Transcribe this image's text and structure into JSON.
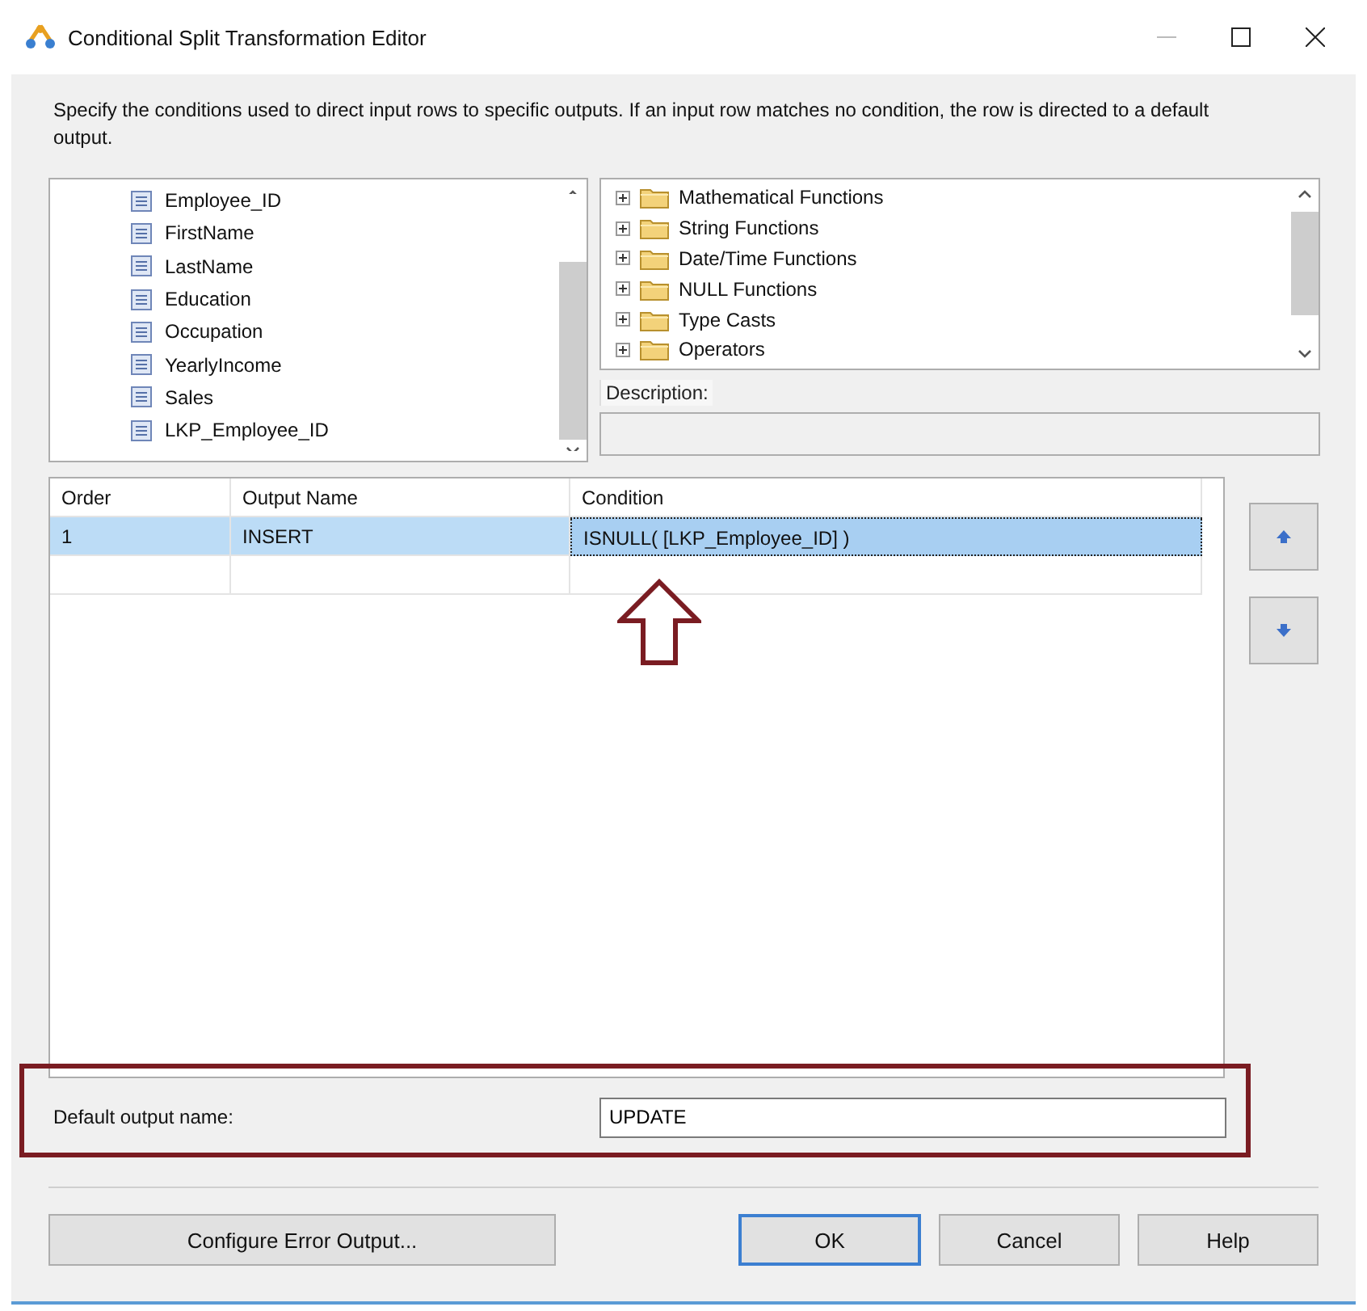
{
  "window": {
    "title": "Conditional Split Transformation Editor"
  },
  "intro": "Specify the conditions used to direct input rows to specific outputs. If an input row matches no condition, the row is directed to a default output.",
  "columns_list": {
    "items": [
      "Employee_ID",
      "FirstName",
      "LastName",
      "Education",
      "Occupation",
      "YearlyIncome",
      "Sales",
      "LKP_Employee_ID"
    ]
  },
  "functions_tree": {
    "items": [
      {
        "label": "Mathematical Functions",
        "expanded": false
      },
      {
        "label": "String Functions",
        "expanded": false
      },
      {
        "label": "Date/Time Functions",
        "expanded": false
      },
      {
        "label": "NULL Functions",
        "expanded": false
      },
      {
        "label": "Type Casts",
        "expanded": false
      },
      {
        "label": "Operators",
        "expanded": false
      }
    ]
  },
  "description": {
    "label": "Description:"
  },
  "table": {
    "columns": [
      "Order",
      "Output Name",
      "Condition"
    ],
    "rows": [
      {
        "cells": [
          "1",
          "INSERT",
          "ISNULL( [LKP_Employee_ID] )"
        ],
        "selected": true
      }
    ]
  },
  "default_output": {
    "label": "Default output name:",
    "value": "UPDATE"
  },
  "buttons": [
    {
      "label": "Configure Error Output...",
      "kind": "wide"
    },
    {
      "label": "OK",
      "kind": "default"
    },
    {
      "label": "Cancel",
      "kind": "normal"
    },
    {
      "label": "Help",
      "kind": "normal"
    }
  ]
}
